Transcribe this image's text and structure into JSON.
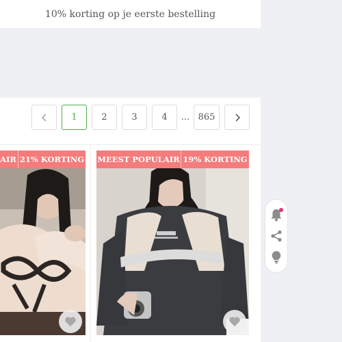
{
  "promo": {
    "text": "10% korting op je eerste bestelling"
  },
  "pagination": {
    "prev_icon": "chevron-left-icon",
    "next_icon": "chevron-right-icon",
    "pages": [
      "1",
      "2",
      "3",
      "4"
    ],
    "active_page": "1",
    "ellipsis": "...",
    "last_page": "865"
  },
  "products": [
    {
      "badges": [
        "LAIR",
        "21% KORTING"
      ],
      "image": "woman in beige sweater with black bow pattern",
      "favorite_icon": "heart-icon"
    },
    {
      "badges": [
        "MEEST POPULAIR",
        "19% KORTING"
      ],
      "image": "woman in dark gray raglan sweatshirt with white print",
      "favorite_icon": "heart-icon"
    }
  ],
  "toolbar": {
    "items": [
      {
        "icon": "bell-icon",
        "has_notification": true
      },
      {
        "icon": "share-icon"
      },
      {
        "icon": "lightbulb-icon"
      }
    ]
  },
  "colors": {
    "badge": "#f47c7c",
    "active_page": "#4cae4c",
    "notification": "#e8336b"
  }
}
